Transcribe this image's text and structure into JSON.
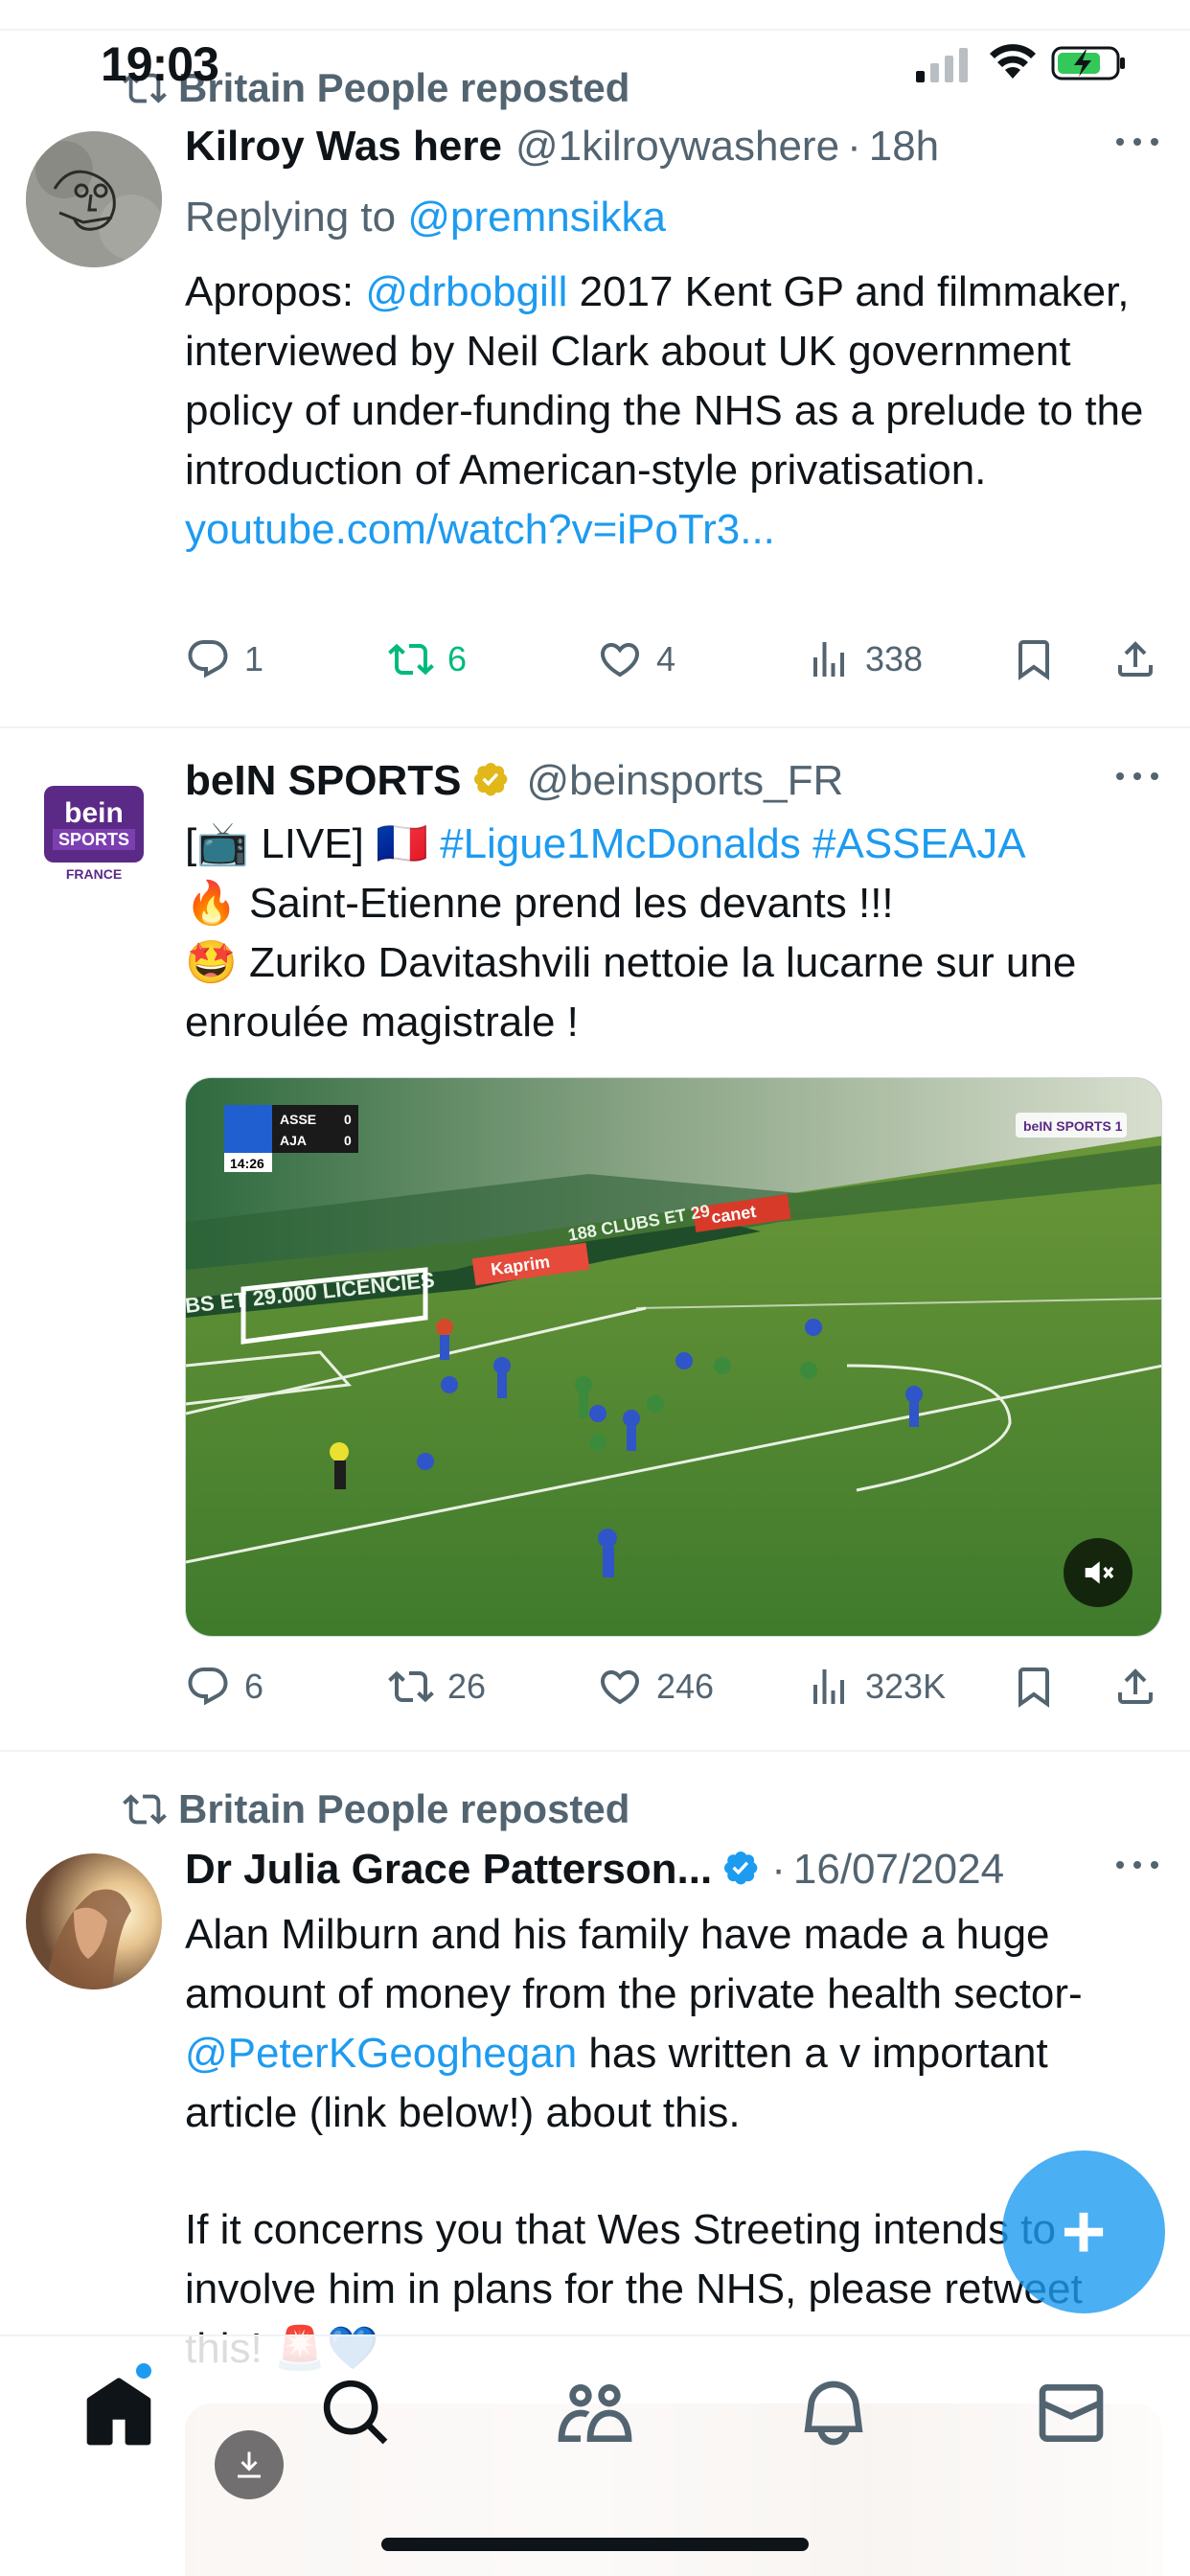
{
  "status_bar": {
    "time": "19:03"
  },
  "tweets": [
    {
      "repost_label": "Britain People reposted",
      "name": "Kilroy Was here",
      "handle": "@1kilroywashere",
      "time": "18h",
      "reply_prefix": "Replying to",
      "reply_to": "@premnsikka",
      "text_parts": {
        "p1": "Apropos: ",
        "mention": "@drbobgill",
        "p2": " 2017 Kent GP and filmmaker, interviewed by Neil Clark about UK government policy of under-funding the NHS as a prelude to the introduction of American-style privatisation. ",
        "link": "youtube.com/watch?v=iPoTr3..."
      },
      "stats": {
        "replies": "1",
        "reposts": "6",
        "likes": "4",
        "views": "338"
      }
    },
    {
      "name": "beIN SPORTS",
      "handle": "@beinsports_FR",
      "avatar_lines": [
        "bein",
        "SPORTS",
        "FRANCE"
      ],
      "text_parts": {
        "line1_a": "[📺 LIVE] 🇫🇷 ",
        "hashtags": "#Ligue1McDonalds #ASSEAJA",
        "line2": "🔥 Saint-Etienne prend les devants !!!",
        "line3": "🤩 Zuriko Davitashvili nettoie la lucarne sur une enroulée magistrale !"
      },
      "video": {
        "score_home": "ASSE",
        "score_home_value": "0",
        "score_away": "AJA",
        "score_away_value": "0",
        "clock": "14:26",
        "channel": "beIN SPORTS 1",
        "boards": [
          "188 CLUBS ET 29",
          "Kaprim",
          "canet",
          "BS ET 29.000 LICENCIES"
        ]
      },
      "stats": {
        "replies": "6",
        "reposts": "26",
        "likes": "246",
        "views": "323K"
      }
    },
    {
      "repost_label": "Britain People reposted",
      "name": "Dr Julia Grace Patterson...",
      "time": "16/07/2024",
      "text_parts": {
        "p1": "Alan Milburn and his family have made a huge amount of money from the private health sector- ",
        "mention": "@PeterKGeoghegan",
        "p2": " has written a v important article (link below!) about this.",
        "p3": "If it concerns you that Wes Streeting intends to involve him in plans for the NHS, please retweet this! 🚨💙"
      }
    }
  ],
  "fab": {
    "label": "+"
  },
  "tabbar": {
    "items": [
      "home-icon",
      "search-icon",
      "communities-icon",
      "notifications-icon",
      "messages-icon"
    ]
  },
  "colors": {
    "accent": "#1d9bf0",
    "repost_green": "#00ba7c",
    "muted": "#536471"
  }
}
